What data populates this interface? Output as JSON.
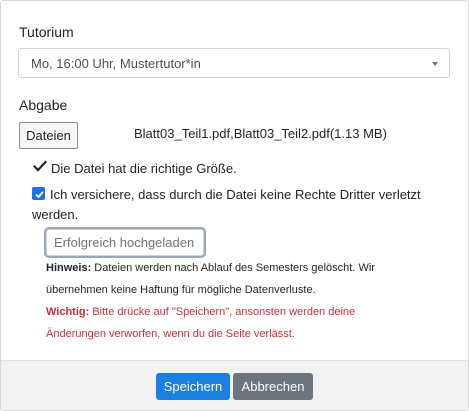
{
  "form": {
    "tutorium_label": "Tutorium",
    "tutorium_selected": "Mo, 16:00 Uhr, Mustertutor*in",
    "abgabe_label": "Abgabe",
    "file_button_label": "Dateien",
    "file_names": "Blatt03_Teil1.pdf,Blatt03_Teil2.pdf(1.13 MB)",
    "size_ok_text": "Die Datei hat die richtige Größe.",
    "confirm_line1": "Ich versichere, dass durch die Datei keine Rechte Dritter verletzt",
    "confirm_line2": "werden.",
    "confirm_checked": true,
    "upload_status": "Erfolgreich hochgeladen",
    "hint_label": "Hinweis:",
    "hint_line1": " Dateien werden nach Ablauf des Semesters gelöscht. Wir",
    "hint_line2": "übernehmen keine Haftung für mögliche Datenverluste.",
    "warning_label": "Wichtig:",
    "warning_line1": " Bitte drücke auf \"Speichern\", ansonsten werden deine",
    "warning_line2": "Änderungen verworfen, wenn du die Seite verlässt."
  },
  "footer": {
    "save_label": "Speichern",
    "cancel_label": "Abbrechen"
  },
  "icons": {
    "check": "check-icon",
    "dropdown": "chevron-down-icon"
  },
  "colors": {
    "primary": "#1d7fe0",
    "secondary": "#6c757d",
    "warning_text": "#c0323c",
    "checkbox": "#1a73e8"
  }
}
